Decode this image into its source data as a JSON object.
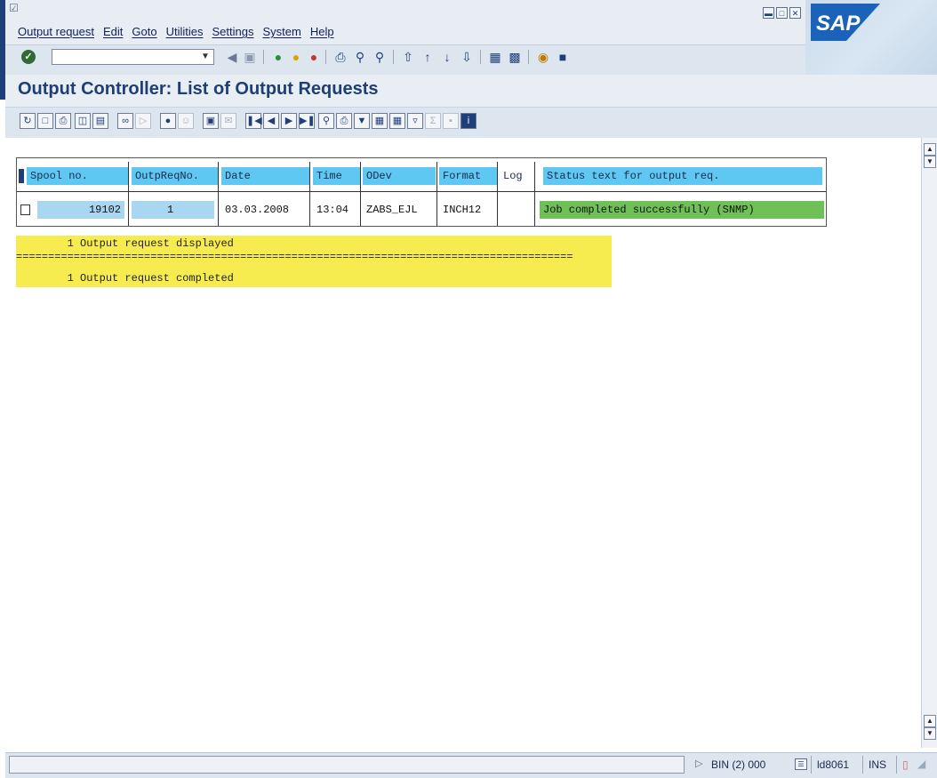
{
  "menu": {
    "items": [
      "Output request",
      "Edit",
      "Goto",
      "Utilities",
      "Settings",
      "System",
      "Help"
    ]
  },
  "branding": {
    "logo_text": "SAP"
  },
  "page": {
    "title": "Output Controller: List of Output Requests"
  },
  "table": {
    "headers": [
      "Spool no.",
      "OutpReqNo.",
      "Date",
      "Time",
      "ODev",
      "Format",
      "Log",
      "Status text for output req."
    ],
    "row": {
      "spool_no": "19102",
      "outp_req_no": "1",
      "date": "03.03.2008",
      "time": "13:04",
      "odev": "ZABS_EJL",
      "format": "INCH12",
      "log": "",
      "status": "Job completed successfully (SNMP)"
    }
  },
  "messages": {
    "line1": "        1 Output request displayed",
    "separator": "=======================================================================================",
    "line2": "        1 Output request completed"
  },
  "statusbar": {
    "system": "BIN (2) 000",
    "server": "ld8061",
    "mode": "INS"
  },
  "colors": {
    "header_cell": "#5ec7f2",
    "status_ok": "#6fc157",
    "message_bg": "#f6ec4f",
    "title_blue": "#1d3f74"
  }
}
